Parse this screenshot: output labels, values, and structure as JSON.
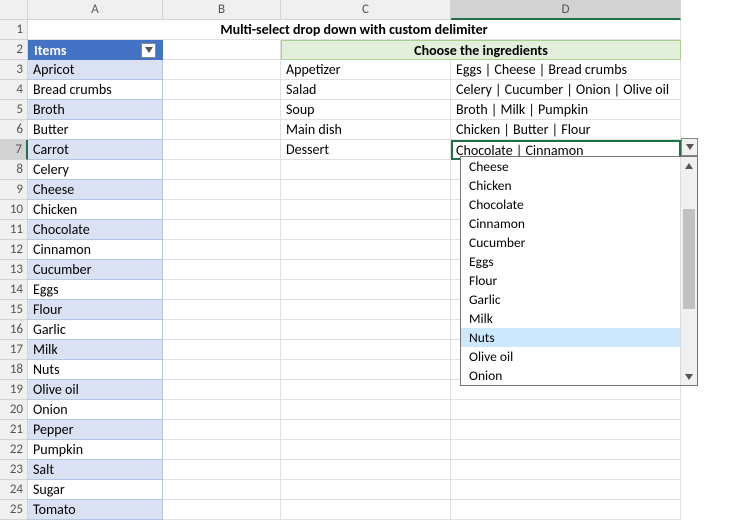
{
  "columns": [
    "A",
    "B",
    "C",
    "D"
  ],
  "row_count": 25,
  "title": "Multi-select drop down with custom delimiter",
  "items_header": "Items",
  "items": [
    "Apricot",
    "Bread crumbs",
    "Broth",
    "Butter",
    "Carrot",
    "Celery",
    "Cheese",
    "Chicken",
    "Chocolate",
    "Cinnamon",
    "Cucumber",
    "Eggs",
    "Flour",
    "Garlic",
    "Milk",
    "Nuts",
    "Olive oil",
    "Onion",
    "Pepper",
    "Pumpkin",
    "Salt",
    "Sugar",
    "Tomato"
  ],
  "choose_header": "Choose the ingredients",
  "dishes": [
    {
      "name": "Appetizer",
      "ingredients": "Eggs | Cheese | Bread crumbs"
    },
    {
      "name": "Salad",
      "ingredients": "Celery | Cucumber | Onion | Olive oil"
    },
    {
      "name": "Soup",
      "ingredients": "Broth | Milk | Pumpkin"
    },
    {
      "name": "Main dish",
      "ingredients": "Chicken | Butter | Flour"
    },
    {
      "name": "Dessert",
      "ingredients": "Chocolate | Cinnamon"
    }
  ],
  "active_cell": {
    "row": 7,
    "col": "D"
  },
  "dropdown": {
    "visible_options": [
      "Cheese",
      "Chicken",
      "Chocolate",
      "Cinnamon",
      "Cucumber",
      "Eggs",
      "Flour",
      "Garlic",
      "Milk",
      "Nuts",
      "Olive oil",
      "Onion"
    ],
    "highlighted": "Nuts"
  }
}
